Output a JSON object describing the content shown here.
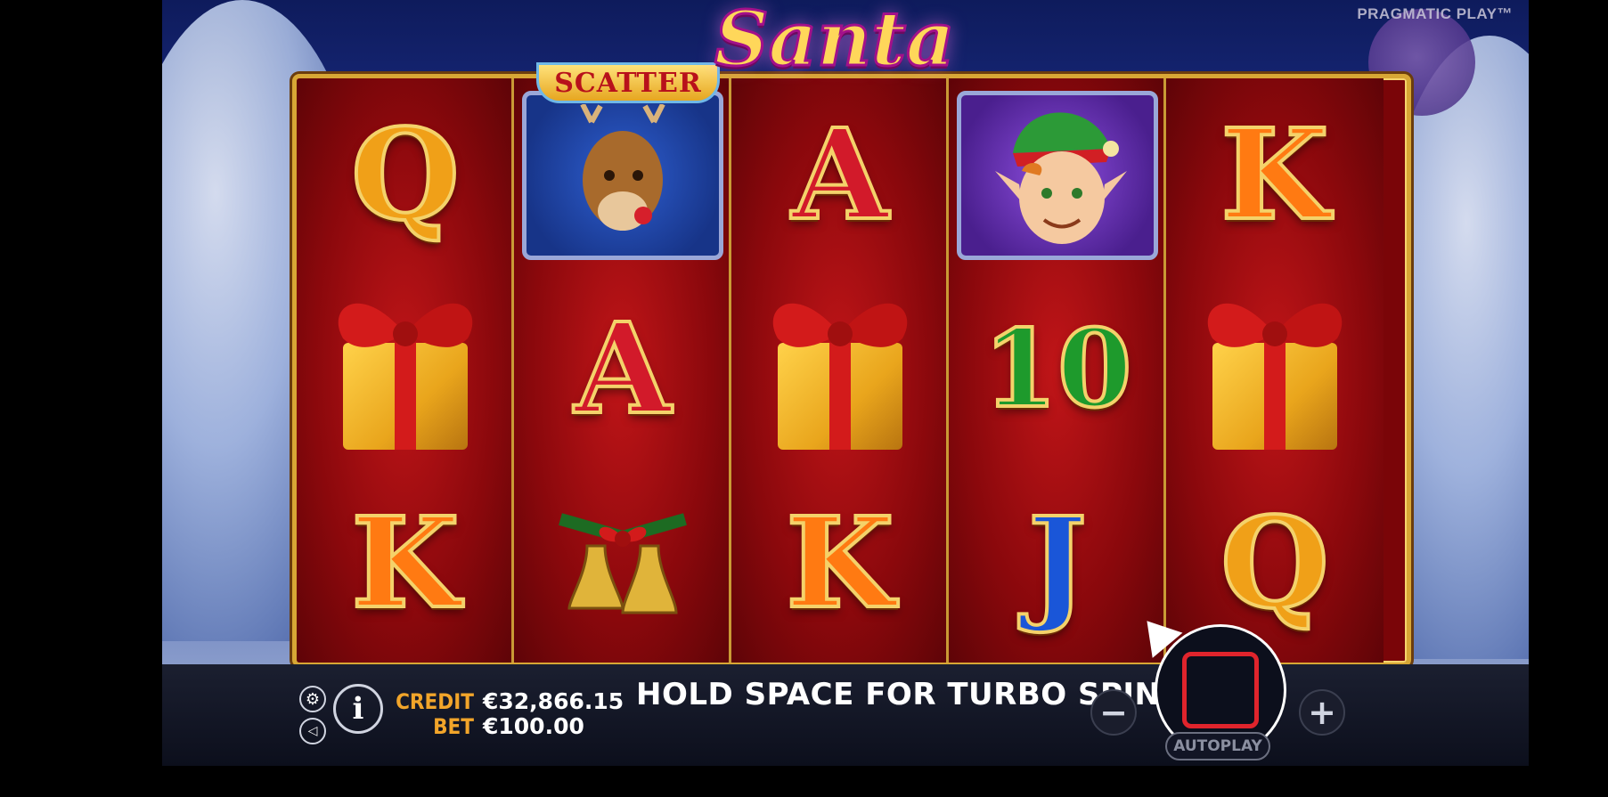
{
  "header": {
    "logo_text": "Santa",
    "brand": "PRAGMATIC PLAY™",
    "scatter_label": "SCATTER"
  },
  "reels": [
    [
      "Q",
      "gift",
      "K"
    ],
    [
      "reindeer",
      "A",
      "bells"
    ],
    [
      "A",
      "gift",
      "K"
    ],
    [
      "elf",
      "10",
      "J"
    ],
    [
      "K",
      "gift",
      "Q"
    ]
  ],
  "bottom_bar": {
    "credit_label": "CREDIT",
    "credit_value": "€32,866.15",
    "bet_label": "BET",
    "bet_value": "€100.00",
    "message": "HOLD SPACE FOR TURBO SPIN",
    "autoplay_label": "AUTOPLAY",
    "info_label": "i",
    "minus_label": "−",
    "plus_label": "+"
  },
  "colors": {
    "accent_gold": "#d8a735",
    "credit_label": "#f2a52a",
    "spin_stop": "#e0242c"
  }
}
